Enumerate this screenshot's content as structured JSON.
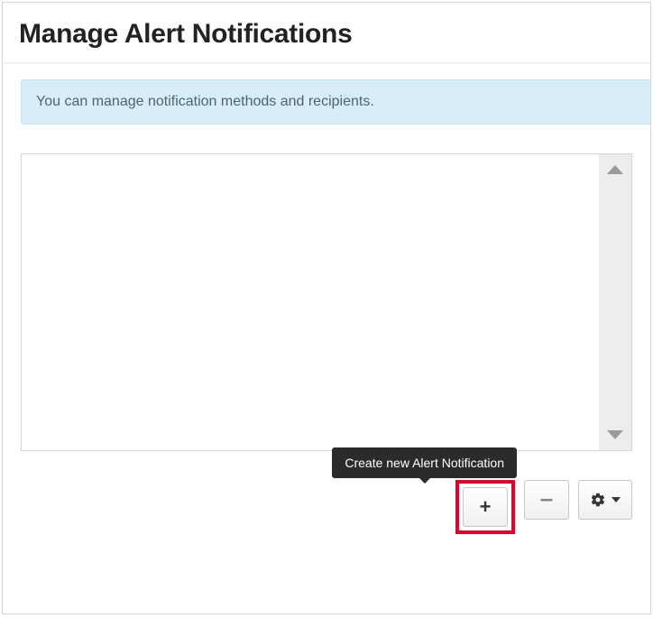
{
  "header": {
    "title": "Manage Alert Notifications"
  },
  "info": {
    "message": "You can manage notification methods and recipients."
  },
  "tooltip": {
    "create": "Create new Alert Notification"
  },
  "icons": {
    "plus": "+",
    "minus": "–"
  }
}
